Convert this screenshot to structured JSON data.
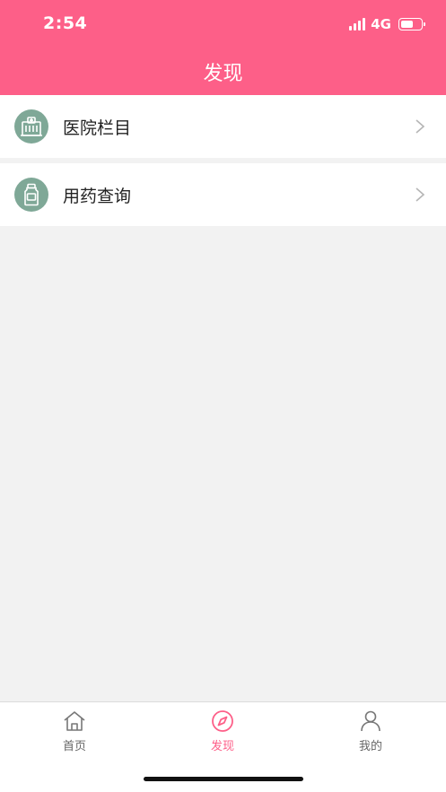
{
  "status_bar": {
    "time": "2:54",
    "network": "4G",
    "battery_level_percent": 60
  },
  "header": {
    "title": "发现",
    "background_color": "#fd5f88"
  },
  "list": {
    "items": [
      {
        "label": "医院栏目",
        "icon": "hospital-icon"
      },
      {
        "label": "用药查询",
        "icon": "medicine-bottle-icon"
      }
    ],
    "icon_background_color": "#7fa897"
  },
  "tabbar": {
    "active_color": "#fd5f88",
    "tabs": [
      {
        "label": "首页",
        "icon": "home-icon"
      },
      {
        "label": "发现",
        "icon": "compass-icon",
        "active": true
      },
      {
        "label": "我的",
        "icon": "user-icon"
      }
    ]
  }
}
